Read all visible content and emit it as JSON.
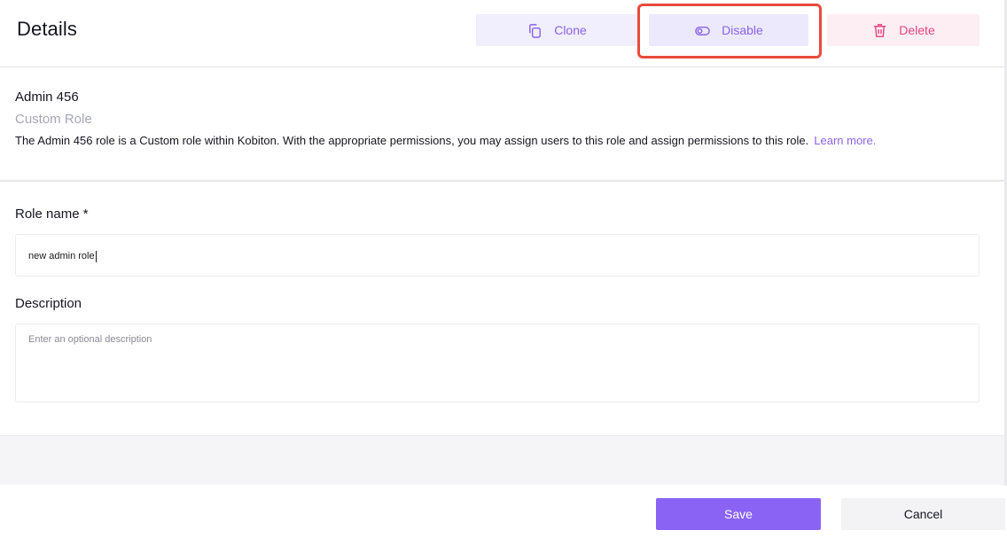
{
  "header": {
    "title": "Details",
    "actions": {
      "clone": {
        "label": "Clone",
        "icon": "copy-icon"
      },
      "disable": {
        "label": "Disable",
        "icon": "toggle-icon"
      },
      "delete": {
        "label": "Delete",
        "icon": "trash-icon"
      }
    }
  },
  "role": {
    "name": "Admin 456",
    "type": "Custom Role",
    "description_prefix": "The ",
    "description_name": "Admin 456",
    "description_suffix": " role is a Custom role within Kobiton. With the appropriate permissions, you may assign users to this role and assign permissions to this role.",
    "learn_more": "Learn more."
  },
  "form": {
    "role_name_label": "Role name *",
    "role_name_value": "new admin role",
    "description_label": "Description",
    "description_placeholder": "Enter an optional description"
  },
  "footer": {
    "save_label": "Save",
    "cancel_label": "Cancel"
  },
  "colors": {
    "accent": "#8a63f5",
    "danger": "#e8467f",
    "highlight": "#e94a3c"
  }
}
